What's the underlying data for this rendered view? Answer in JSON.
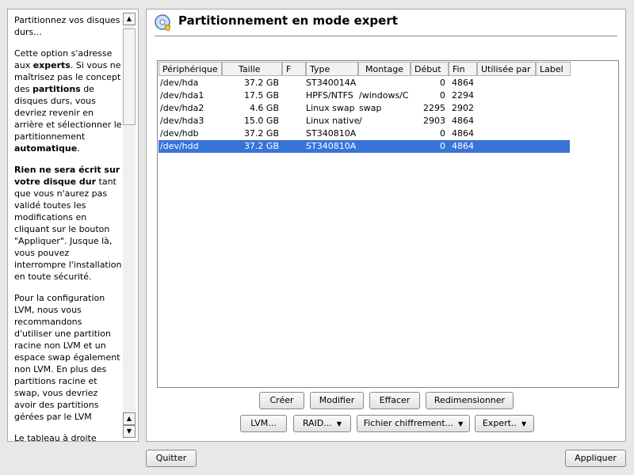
{
  "help": {
    "paragraphs": [
      "Partitionnez vos disques durs...",
      "Cette option s'adresse aux experts. Si vous ne maîtrisez pas le concept des partitions de disques durs, vous devriez revenir en arrière et sélectionner le partitionnement automatique.",
      "Rien ne sera écrit sur votre disque dur tant que vous n'aurez pas validé toutes les modifications en cliquant sur le bouton \"Appliquer\". Jusque là, vous pouvez interrompre l'installation en toute sécurité.",
      "Pour la configuration LVM, nous vous recommandons d'utiliser une partition racine non LVM et un espace swap également non LVM. En plus des partitions racine et swap, vous devriez avoir des partitions gérées par le LVM",
      "Le tableau à droite montre les partitions"
    ],
    "bold": {
      "experts": "experts",
      "partitions": "partitions",
      "automatique": "automatique",
      "rien": "Rien ne sera écrit sur votre disque dur"
    }
  },
  "main": {
    "title": "Partitionnement en mode expert"
  },
  "table": {
    "columns": [
      "Périphérique",
      "Taille",
      "F",
      "Type",
      "Montage",
      "Début",
      "Fin",
      "Utilisée par",
      "Label"
    ],
    "rows": [
      {
        "dev": "/dev/hda",
        "size": "37.2 GB",
        "f": "",
        "type": "ST340014A",
        "mount": "",
        "start": "0",
        "end": "4864",
        "used": "",
        "label": ""
      },
      {
        "dev": "/dev/hda1",
        "size": "17.5 GB",
        "f": "",
        "type": "HPFS/NTFS",
        "mount": "/windows/C",
        "start": "0",
        "end": "2294",
        "used": "",
        "label": ""
      },
      {
        "dev": "/dev/hda2",
        "size": "4.6 GB",
        "f": "",
        "type": "Linux swap",
        "mount": "swap",
        "start": "2295",
        "end": "2902",
        "used": "",
        "label": ""
      },
      {
        "dev": "/dev/hda3",
        "size": "15.0 GB",
        "f": "",
        "type": "Linux native",
        "mount": "/",
        "start": "2903",
        "end": "4864",
        "used": "",
        "label": ""
      },
      {
        "dev": "/dev/hdb",
        "size": "37.2 GB",
        "f": "",
        "type": "ST340810A",
        "mount": "",
        "start": "0",
        "end": "4864",
        "used": "",
        "label": ""
      },
      {
        "dev": "/dev/hdd",
        "size": "37.2 GB",
        "f": "",
        "type": "ST340810A",
        "mount": "",
        "start": "0",
        "end": "4864",
        "used": "",
        "label": ""
      }
    ],
    "selected_index": 5
  },
  "buttons": {
    "creer": "Créer",
    "modifier": "Modifier",
    "effacer": "Effacer",
    "redimensionner": "Redimensionner",
    "lvm": "LVM...",
    "raid": "RAID...",
    "fichier": "Fichier chiffrement...",
    "expert": "Expert..",
    "quitter": "Quitter",
    "appliquer": "Appliquer"
  },
  "colors": {
    "selection": "#3874d8"
  }
}
